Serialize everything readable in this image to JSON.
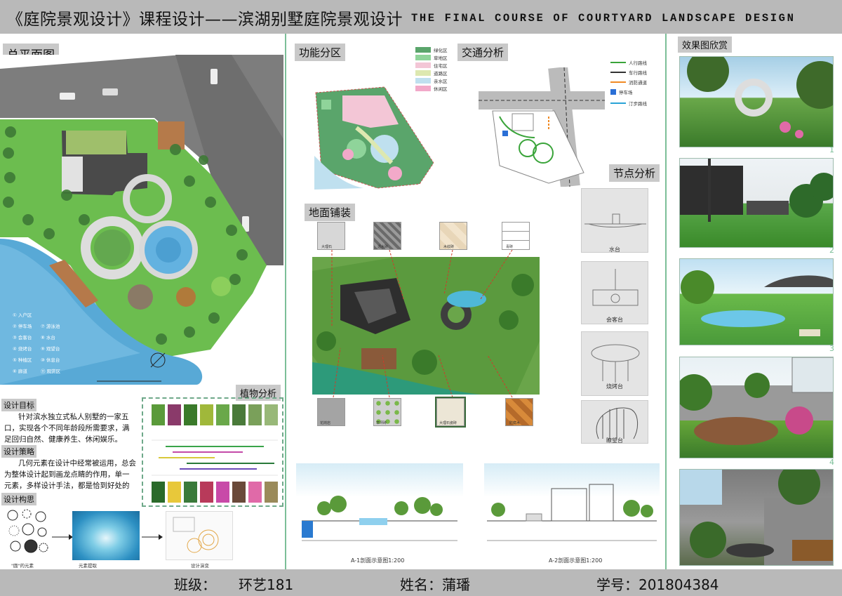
{
  "header": {
    "title_cn": "《庭院景观设计》课程设计——滨湖别墅庭院景观设计",
    "title_en": "THE FINAL COURSE OF COURTYARD LANDSCAPE DESIGN"
  },
  "sections": {
    "master_plan": "总平面图",
    "function_zone": "功能分区",
    "traffic": "交通分析",
    "node": "节点分析",
    "paving": "地面铺装",
    "plants": "植物分析",
    "renders": "效果图欣赏",
    "goal": "设计目标",
    "strategy": "设计策略",
    "concept": "设计构思"
  },
  "texts": {
    "goal_body": "针对滨水独立式私人别墅的一家五口，实现各个不同年龄段所需要求，满足回归自然、健康养生、休闲娱乐。",
    "strategy_body": "几何元素在设计中经常被运用，总会为整体设计起到画龙点睛的作用，单一元素，多样设计手法，都是恰到好处的景致一圆。",
    "concept_labels": [
      "\"圆\"的元素",
      "元素提取",
      "设计演变"
    ]
  },
  "plan_legend": [
    {
      "n": "1",
      "label": "入户区"
    },
    {
      "n": "2",
      "label": "停车场"
    },
    {
      "n": "3",
      "label": "会客台"
    },
    {
      "n": "4",
      "label": "烧烤台"
    },
    {
      "n": "5",
      "label": "种植区"
    },
    {
      "n": "6",
      "label": "廊道"
    },
    {
      "n": "7",
      "label": "游泳池"
    },
    {
      "n": "8",
      "label": "水台"
    },
    {
      "n": "9",
      "label": "观望台"
    },
    {
      "n": "10",
      "label": "休息台"
    },
    {
      "n": "11",
      "label": "观赏区"
    }
  ],
  "function_legend": [
    {
      "label": "绿化区",
      "color": "#5aa56b"
    },
    {
      "label": "草地区",
      "color": "#8fd49a"
    },
    {
      "label": "住宅区",
      "color": "#f3c6d6"
    },
    {
      "label": "道路区",
      "color": "#dde8b0"
    },
    {
      "label": "亲水区",
      "color": "#bfe0ef"
    },
    {
      "label": "休闲区",
      "color": "#f2a9c9"
    }
  ],
  "traffic_legend": [
    {
      "label": "人行路线",
      "color": "#3aa43a"
    },
    {
      "label": "车行路线",
      "color": "#333333"
    },
    {
      "label": "消防通道",
      "color": "#f08a24"
    },
    {
      "label": "停车场",
      "color": "#2a6fd6"
    },
    {
      "label": "汀步路线",
      "color": "#2aa3d6"
    }
  ],
  "paving_labels": [
    "大理石",
    "透水砖",
    "木纹砖",
    "青砖",
    "花岗岩",
    "草坪砖",
    "大理石瓷砖",
    "防腐木"
  ],
  "nodes": [
    "水台",
    "会客台",
    "烧烤台",
    "瞭望台"
  ],
  "sections_labels": {
    "a1": "A-1剖面示意图1:200",
    "a2": "A-2剖面示意图1:200"
  },
  "render_numbers": [
    "1",
    "2",
    "3",
    "4"
  ],
  "footer": {
    "class_label": "班级：",
    "class_value": "环艺181",
    "name_label": "姓名：蒲璠",
    "id_label": "学号：201804384"
  },
  "colors": {
    "header_bg": "#b9b9b9",
    "accent_green": "#7cbf98",
    "water": "#6fb7d8",
    "lawn": "#59a84a"
  }
}
